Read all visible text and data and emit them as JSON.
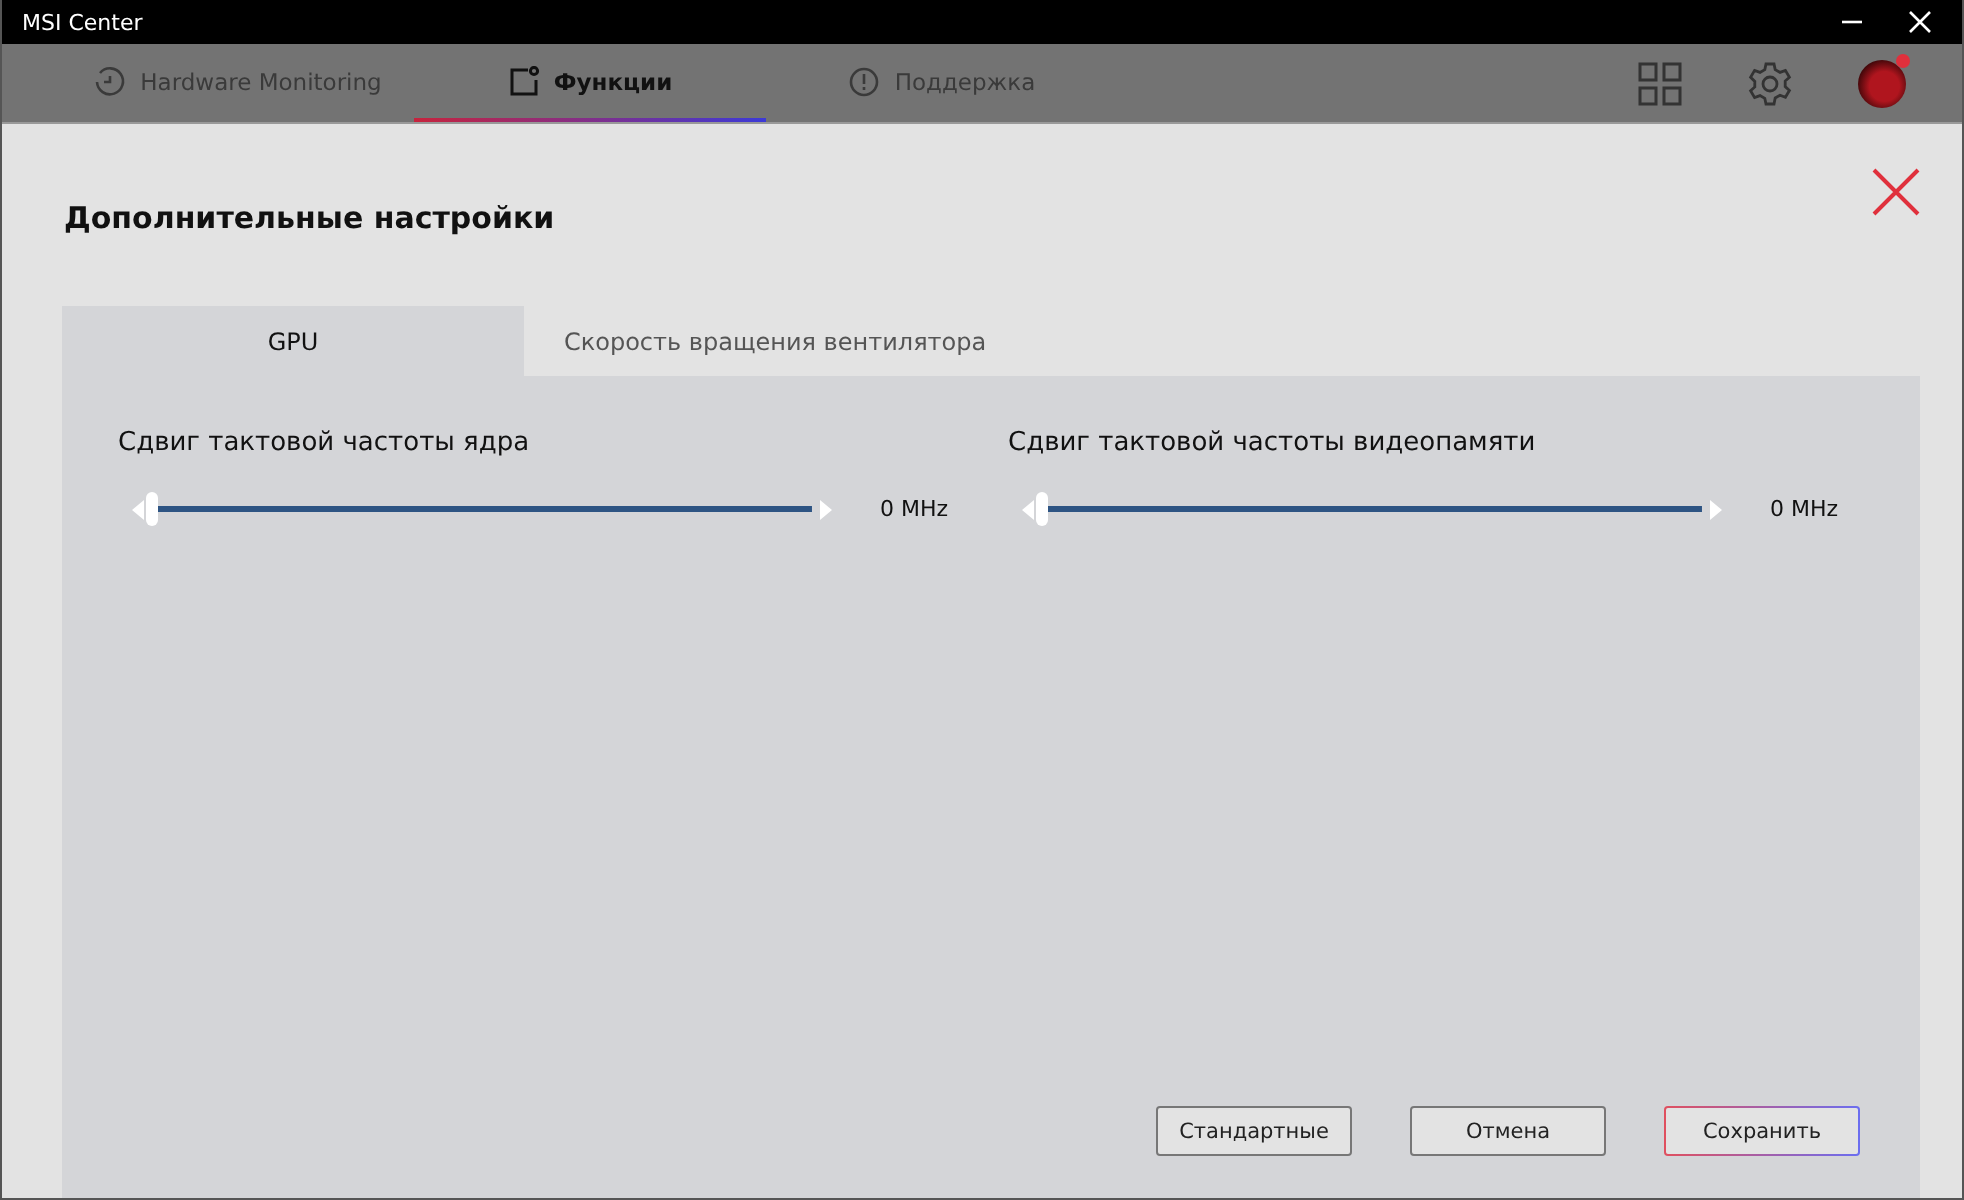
{
  "window": {
    "title": "MSI Center"
  },
  "nav_tabs": [
    {
      "label": "Hardware Monitoring",
      "kind": "clock",
      "selected": false
    },
    {
      "label": "Функции",
      "kind": "square",
      "selected": true
    },
    {
      "label": "Поддержка",
      "kind": "alert",
      "selected": false
    }
  ],
  "dialog": {
    "title": "Дополнительные настройки",
    "tabs": [
      {
        "label": "GPU",
        "selected": true
      },
      {
        "label": "Скорость вращения вентилятора",
        "selected": false
      }
    ],
    "sliders": [
      {
        "label": "Сдвиг тактовой частоты ядра",
        "level": 0,
        "reading": "0 MHz"
      },
      {
        "label": "Сдвиг тактовой частоты видеопамяти",
        "level": 0,
        "reading": "0 MHz"
      }
    ],
    "buttons": [
      {
        "label": "Стандартные",
        "kind": "plain"
      },
      {
        "label": "Отмена",
        "kind": "plain"
      },
      {
        "label": "Сохранить",
        "kind": "primary"
      }
    ]
  }
}
